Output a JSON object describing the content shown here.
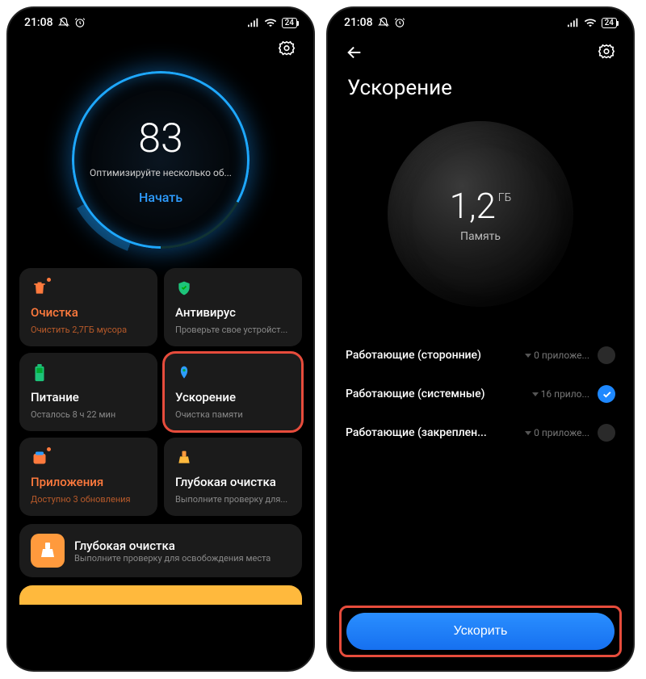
{
  "status": {
    "time": "21:08",
    "battery": "24"
  },
  "screen1": {
    "score": "83",
    "hint": "Оптимизируйте несколько об...",
    "start": "Начать",
    "tiles": [
      {
        "name": "cleaner",
        "label": "Очистка",
        "sub": "Очистить 2,7ГБ мусора",
        "color": "orange",
        "icon": "trash",
        "dot": true
      },
      {
        "name": "antivirus",
        "label": "Антивирус",
        "sub": "Проверьте свое устройст...",
        "color": "",
        "icon": "shield"
      },
      {
        "name": "battery",
        "label": "Питание",
        "sub": "Осталось 8 ч 22 мин",
        "color": "",
        "icon": "battery"
      },
      {
        "name": "boost",
        "label": "Ускорение",
        "sub": "Очистка памяти",
        "color": "",
        "icon": "rocket",
        "highlight": true
      },
      {
        "name": "apps",
        "label": "Приложения",
        "sub": "Доступно 3 обновления",
        "color": "orange",
        "icon": "app",
        "dot": true
      },
      {
        "name": "deepclean",
        "label": "Глубокая очистка",
        "sub": "Выполните проверку для...",
        "color": "",
        "icon": "brush"
      }
    ],
    "bottom": {
      "title": "Глубокая очистка",
      "sub": "Выполните проверку для освобождения места"
    }
  },
  "screen2": {
    "title": "Ускорение",
    "mem_value": "1,2",
    "mem_unit": "ГБ",
    "mem_label": "Память",
    "rows": [
      {
        "label": "Работающие (сторонние)",
        "count": "0 приложе...",
        "checked": false
      },
      {
        "label": "Работающие (системные)",
        "count": "16 прило...",
        "checked": true
      },
      {
        "label": "Работающие (закреплен...",
        "count": "0 приложе...",
        "checked": false
      }
    ],
    "button": "Ускорить"
  }
}
